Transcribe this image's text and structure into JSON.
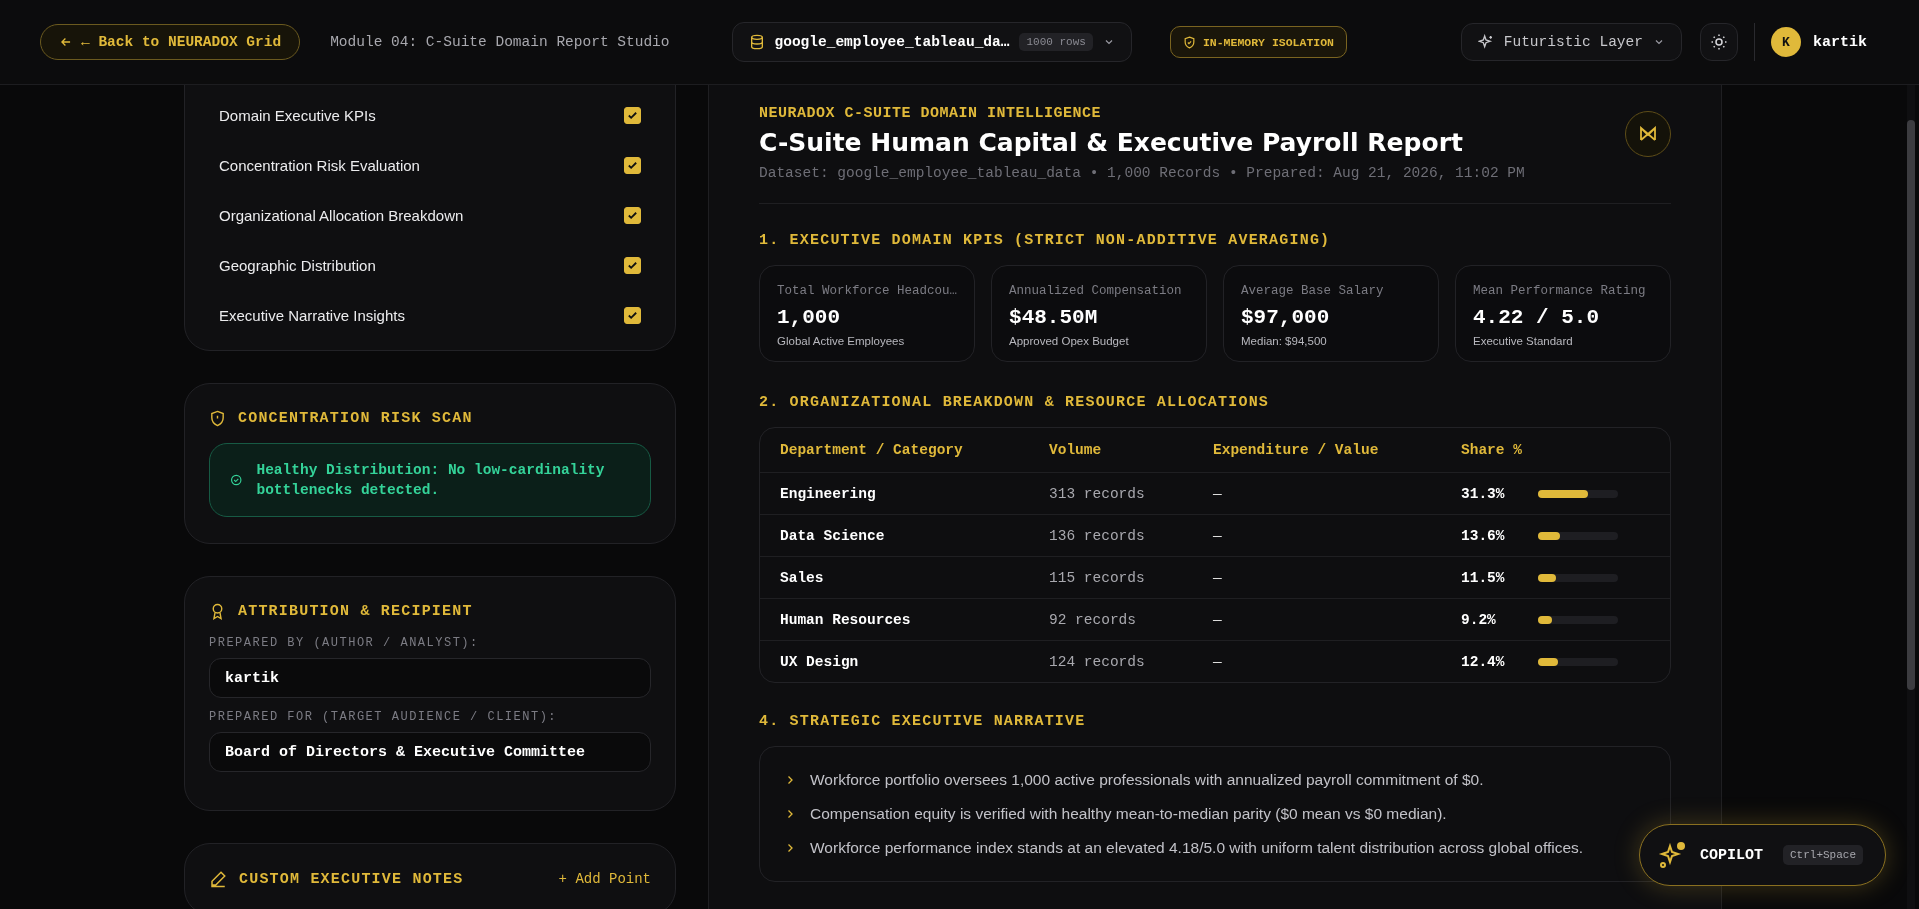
{
  "header": {
    "back_button": "← Back to NEURADOX Grid",
    "module_title": "Module 04: C-Suite Domain Report Studio",
    "dataset_selector": {
      "name": "google_employee_tableau_da…",
      "rows_badge": "1000 rows"
    },
    "isolation_badge": "IN-MEMORY ISOLATION",
    "layer_selector": "Futuristic Layer",
    "user": {
      "initial": "K",
      "name": "kartik"
    }
  },
  "sidebar": {
    "checklist": [
      {
        "label": "Domain Executive KPIs",
        "checked": true
      },
      {
        "label": "Concentration Risk Evaluation",
        "checked": true
      },
      {
        "label": "Organizational Allocation Breakdown",
        "checked": true
      },
      {
        "label": "Geographic Distribution",
        "checked": true
      },
      {
        "label": "Executive Narrative Insights",
        "checked": true
      }
    ],
    "risk_scan": {
      "title": "CONCENTRATION RISK SCAN",
      "message": "Healthy Distribution: No low-cardinality bottlenecks detected."
    },
    "attribution": {
      "title": "ATTRIBUTION & RECIPIENT",
      "prepared_by_label": "PREPARED BY (AUTHOR / ANALYST):",
      "prepared_by": "kartik",
      "prepared_for_label": "PREPARED FOR (TARGET AUDIENCE / CLIENT):",
      "prepared_for": "Board of Directors & Executive Committee"
    },
    "notes": {
      "title": "CUSTOM EXECUTIVE NOTES",
      "add_button": "+ Add Point"
    }
  },
  "report": {
    "eyebrow": "NEURADOX C-SUITE DOMAIN INTELLIGENCE",
    "title": "C-Suite Human Capital & Executive Payroll Report",
    "meta": "Dataset: google_employee_tableau_data • 1,000 Records • Prepared: Aug 21, 2026, 11:02 PM",
    "kpi": {
      "heading": "1. EXECUTIVE DOMAIN KPIS (STRICT NON-ADDITIVE AVERAGING)",
      "cards": [
        {
          "label": "Total Workforce Headcou…",
          "value": "1,000",
          "caption": "Global Active Employees"
        },
        {
          "label": "Annualized Compensation",
          "value": "$48.50M",
          "caption": "Approved Opex Budget"
        },
        {
          "label": "Average Base Salary",
          "value": "$97,000",
          "caption": "Median: $94,500"
        },
        {
          "label": "Mean Performance Rating",
          "value": "4.22 / 5.0",
          "caption": "Executive Standard"
        }
      ]
    },
    "breakdown": {
      "heading": "2. ORGANIZATIONAL BREAKDOWN & RESOURCE ALLOCATIONS",
      "columns": [
        "Department / Category",
        "Volume",
        "Expenditure / Value",
        "Share %"
      ],
      "rows": [
        {
          "name": "Engineering",
          "volume": "313 records",
          "value": "—",
          "share": "31.3%",
          "level": 0.62
        },
        {
          "name": "Data Science",
          "volume": "136 records",
          "value": "—",
          "share": "13.6%",
          "level": 0.27
        },
        {
          "name": "Sales",
          "volume": "115 records",
          "value": "—",
          "share": "11.5%",
          "level": 0.23
        },
        {
          "name": "Human Resources",
          "volume": "92 records",
          "value": "—",
          "share": "9.2%",
          "level": 0.18
        },
        {
          "name": "UX Design",
          "volume": "124 records",
          "value": "—",
          "share": "12.4%",
          "level": 0.25
        }
      ]
    },
    "narrative": {
      "heading": "4. STRATEGIC EXECUTIVE NARRATIVE",
      "items": [
        "Workforce portfolio oversees 1,000 active professionals with annualized payroll commitment of $0.",
        "Compensation equity is verified with healthy mean-to-median parity ($0 mean vs $0 median).",
        "Workforce performance index stands at an elevated 4.18/5.0 with uniform talent distribution across global offices."
      ]
    }
  },
  "copilot": {
    "label": "COPILOT",
    "shortcut": "Ctrl+Space"
  }
}
